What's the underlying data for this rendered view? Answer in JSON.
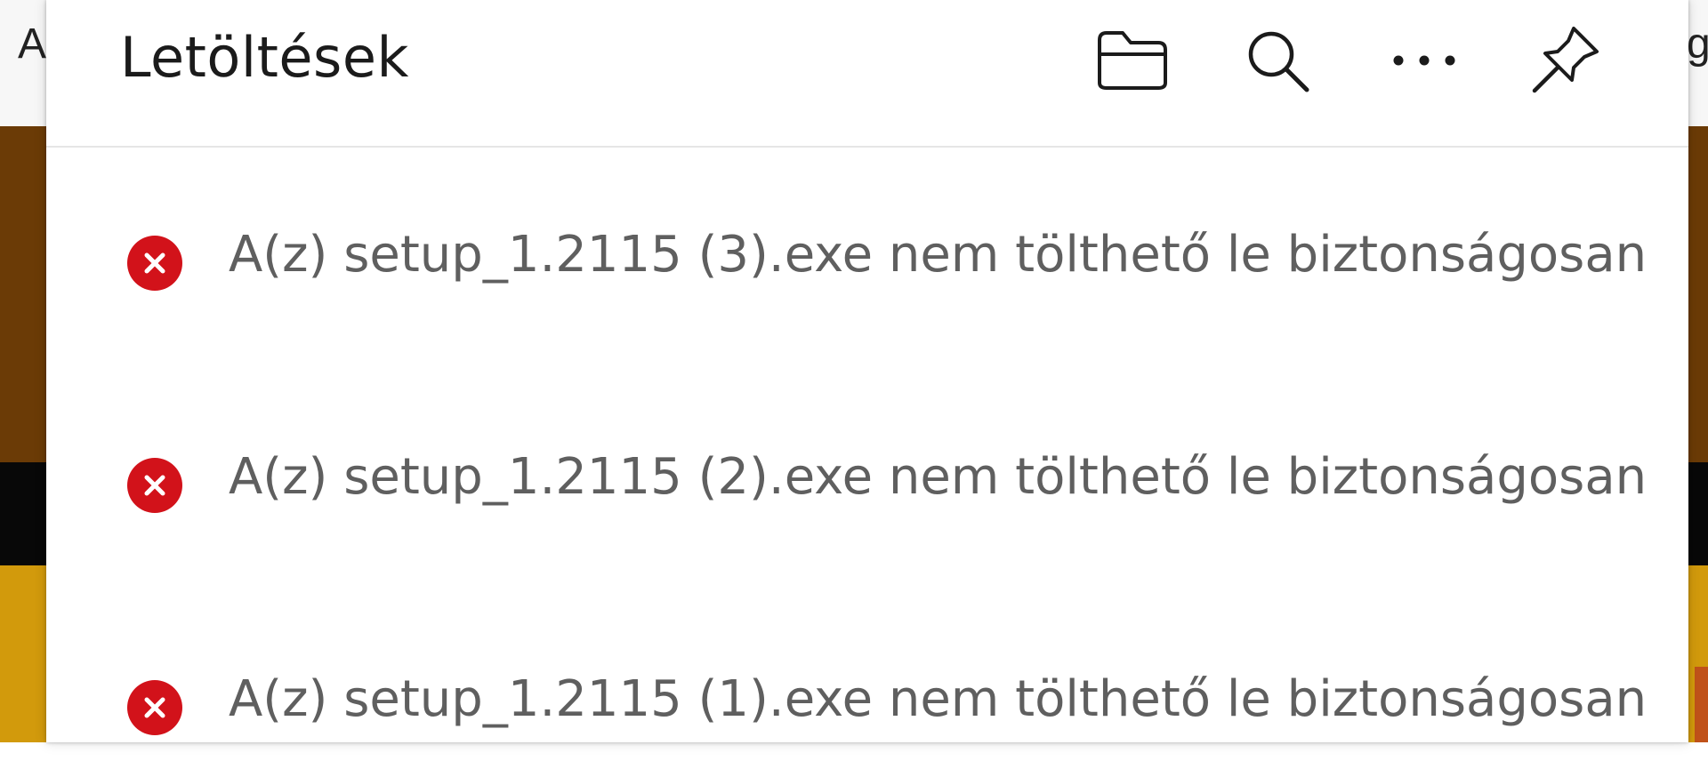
{
  "background": {
    "toolbar_left_glyph": "A",
    "toolbar_right_glyph": "g"
  },
  "downloads": {
    "title": "Letöltések",
    "toolbar": {
      "open_folder_icon": "folder-icon",
      "search_icon": "search-icon",
      "more_icon": "more-horizontal-icon",
      "pin_icon": "pin-icon"
    },
    "items": [
      {
        "status": "blocked",
        "status_icon": "error-icon",
        "message": "A(z) setup_1.2115 (3).exe nem tölthető le biztonságosan"
      },
      {
        "status": "blocked",
        "status_icon": "error-icon",
        "message": "A(z) setup_1.2115 (2).exe nem tölthető le biztonságosan"
      },
      {
        "status": "blocked",
        "status_icon": "error-icon",
        "message": "A(z) setup_1.2115 (1).exe nem tölthető le biztonságosan"
      }
    ]
  },
  "colors": {
    "error_red": "#d2121a",
    "text_primary": "#1b1b1b",
    "text_secondary": "#5f5f5f"
  }
}
